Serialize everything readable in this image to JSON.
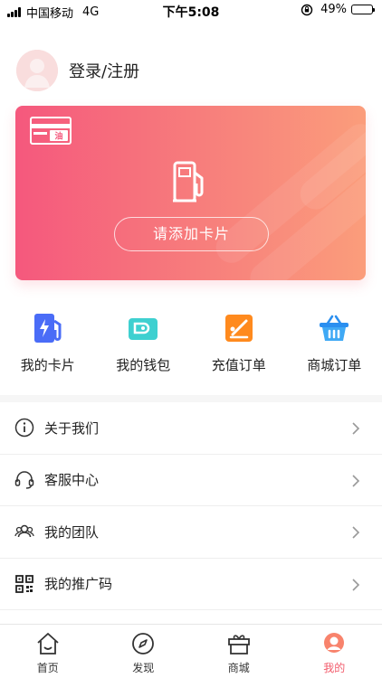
{
  "status_bar": {
    "carrier": "中国移动",
    "network": "4G",
    "time": "下午5:08",
    "battery_text": "49%",
    "battery_level": 0.49
  },
  "profile": {
    "login_label": "登录/注册"
  },
  "card": {
    "badge_text": "油",
    "add_card_label": "请添加卡片",
    "gradient_start": "#f5587d",
    "gradient_end": "#fb9d7b"
  },
  "quick_actions": [
    {
      "label": "我的卡片",
      "icon": "fuel-card-icon"
    },
    {
      "label": "我的钱包",
      "icon": "wallet-icon"
    },
    {
      "label": "充值订单",
      "icon": "recharge-order-icon"
    },
    {
      "label": "商城订单",
      "icon": "shopping-basket-icon"
    }
  ],
  "menu": [
    {
      "label": "关于我们",
      "icon": "info-icon"
    },
    {
      "label": "客服中心",
      "icon": "headset-icon"
    },
    {
      "label": "我的团队",
      "icon": "team-icon"
    },
    {
      "label": "我的推广码",
      "icon": "qr-code-icon"
    }
  ],
  "tabbar": {
    "tabs": [
      {
        "label": "首页",
        "icon": "home-icon"
      },
      {
        "label": "发现",
        "icon": "compass-icon"
      },
      {
        "label": "商城",
        "icon": "gift-icon"
      },
      {
        "label": "我的",
        "icon": "profile-icon"
      }
    ],
    "active_color": "#f25b6b"
  }
}
